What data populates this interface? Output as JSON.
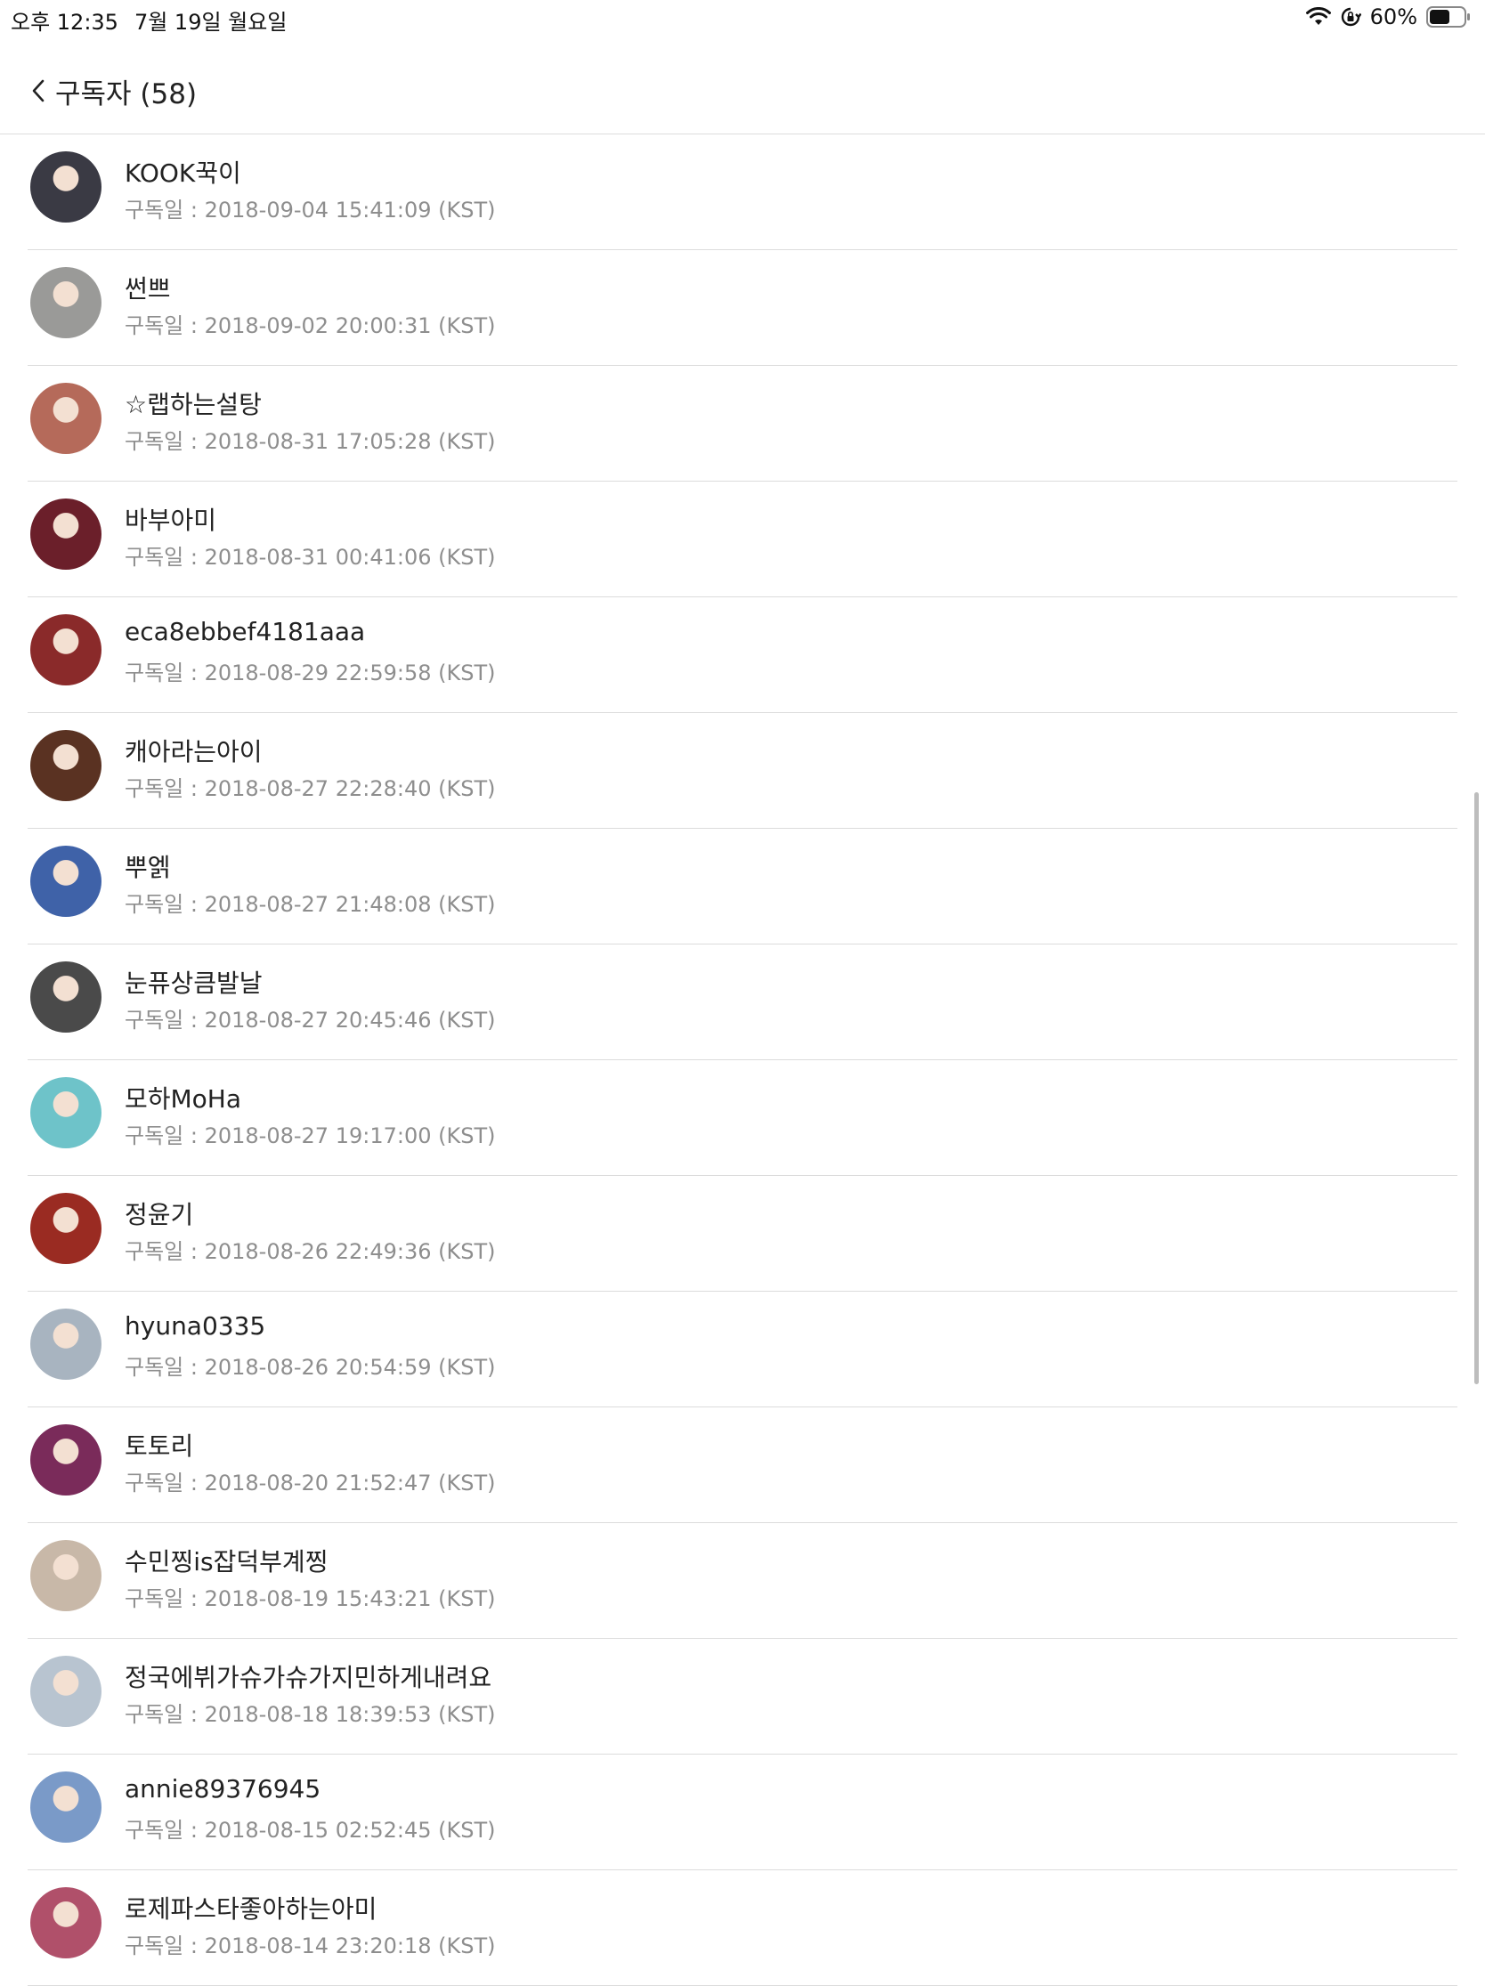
{
  "status_bar": {
    "time": "오후 12:35",
    "date": "7월 19일 월요일",
    "battery": "60%",
    "battery_level": 0.6,
    "icons": [
      "wifi-icon",
      "orientation-lock-icon",
      "battery-icon"
    ]
  },
  "header": {
    "back_icon": "chevron-left-icon",
    "title": "구독자 (58)"
  },
  "subscribers": [
    {
      "name": "KOOK꾹이",
      "date": "구독일 : 2018-09-04 15:41:09 (KST)",
      "avatar_color": "#3a3a44"
    },
    {
      "name": "썬쁘",
      "date": "구독일 : 2018-09-02 20:00:31 (KST)",
      "avatar_color": "#9a9a98"
    },
    {
      "name": "☆랩하는설탕",
      "date": "구독일 : 2018-08-31 17:05:28 (KST)",
      "avatar_color": "#b56a5a"
    },
    {
      "name": "바부아미",
      "date": "구독일 : 2018-08-31 00:41:06 (KST)",
      "avatar_color": "#6b1f2a"
    },
    {
      "name": "eca8ebbef4181aaa",
      "date": "구독일 : 2018-08-29 22:59:58 (KST)",
      "avatar_color": "#8a2a2a"
    },
    {
      "name": "캐아라는아이",
      "date": "구독일 : 2018-08-27 22:28:40 (KST)",
      "avatar_color": "#5a3222"
    },
    {
      "name": "뿌엙",
      "date": "구독일 : 2018-08-27 21:48:08 (KST)",
      "avatar_color": "#3f62a8"
    },
    {
      "name": "눈퓨상큼발날",
      "date": "구독일 : 2018-08-27 20:45:46 (KST)",
      "avatar_color": "#4a4a4a"
    },
    {
      "name": "모하MoHa",
      "date": "구독일 : 2018-08-27 19:17:00 (KST)",
      "avatar_color": "#6ec3c9"
    },
    {
      "name": "정윤기",
      "date": "구독일 : 2018-08-26 22:49:36 (KST)",
      "avatar_color": "#9a2b22"
    },
    {
      "name": "hyuna0335",
      "date": "구독일 : 2018-08-26 20:54:59 (KST)",
      "avatar_color": "#a8b4c0"
    },
    {
      "name": "토토리",
      "date": "구독일 : 2018-08-20 21:52:47 (KST)",
      "avatar_color": "#7a2b5a"
    },
    {
      "name": "수민찡is잡덕부계찡",
      "date": "구독일 : 2018-08-19 15:43:21 (KST)",
      "avatar_color": "#c8b8a8"
    },
    {
      "name": "정국에뷔가슈가슈가지민하게내려요",
      "date": "구독일 : 2018-08-18 18:39:53 (KST)",
      "avatar_color": "#b8c4d0"
    },
    {
      "name": "annie89376945",
      "date": "구독일 : 2018-08-15 02:52:45 (KST)",
      "avatar_color": "#7a9ac8"
    },
    {
      "name": "로제파스타좋아하는아미",
      "date": "구독일 : 2018-08-14 23:20:18 (KST)",
      "avatar_color": "#b0506a"
    }
  ]
}
